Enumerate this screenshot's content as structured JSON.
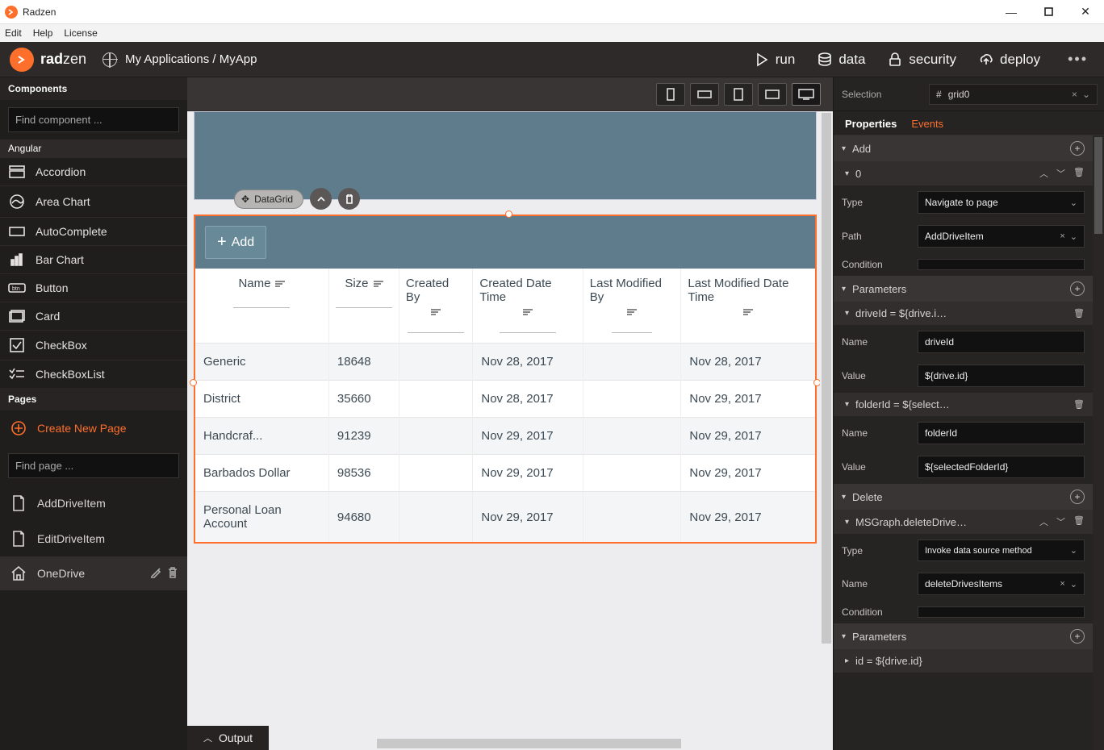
{
  "app_title": "Radzen",
  "menubar": [
    "Edit",
    "Help",
    "License"
  ],
  "brand": {
    "bold": "rad",
    "rest": "zen"
  },
  "breadcrumb": "My Applications / MyApp",
  "top_actions": [
    {
      "id": "run",
      "label": "run"
    },
    {
      "id": "data",
      "label": "data"
    },
    {
      "id": "security",
      "label": "security"
    },
    {
      "id": "deploy",
      "label": "deploy"
    }
  ],
  "components_header": "Components",
  "find_component_placeholder": "Find component ...",
  "component_group": "Angular",
  "components": [
    "Accordion",
    "Area Chart",
    "AutoComplete",
    "Bar Chart",
    "Button",
    "Card",
    "CheckBox",
    "CheckBoxList"
  ],
  "pages_header": "Pages",
  "create_page": "Create New Page",
  "find_page_placeholder": "Find page ...",
  "pages": [
    {
      "name": "AddDriveItem",
      "selected": false
    },
    {
      "name": "EditDriveItem",
      "selected": false
    },
    {
      "name": "OneDrive",
      "selected": true
    }
  ],
  "selection_label": "Selection",
  "selection_value": "grid0",
  "prop_tabs": {
    "properties": "Properties",
    "events": "Events"
  },
  "designer": {
    "tag_label": "DataGrid",
    "add_button": "Add",
    "columns": [
      "Name",
      "Size",
      "Created By",
      "Created Date Time",
      "Last Modified By",
      "Last Modified Date Time"
    ],
    "rows": [
      {
        "name": "Generic",
        "size": "18648",
        "created": "Nov 28, 2017",
        "modified": "Nov 28, 2017"
      },
      {
        "name": "District",
        "size": "35660",
        "created": "Nov 28, 2017",
        "modified": "Nov 29, 2017"
      },
      {
        "name": "Handcraf...",
        "size": "91239",
        "created": "Nov 29, 2017",
        "modified": "Nov 29, 2017"
      },
      {
        "name": "Barbados Dollar",
        "size": "98536",
        "created": "Nov 29, 2017",
        "modified": "Nov 29, 2017"
      },
      {
        "name": "Personal Loan Account",
        "size": "94680",
        "created": "Nov 29, 2017",
        "modified": "Nov 29, 2017"
      }
    ]
  },
  "props_panel": {
    "add_section": "Add",
    "item0": "0",
    "type_label": "Type",
    "type_value": "Navigate to page",
    "path_label": "Path",
    "path_value": "AddDriveItem",
    "condition_label": "Condition",
    "condition_value": "",
    "params_section": "Parameters",
    "param1_header": "driveId = ${drive.i…",
    "param1_name_label": "Name",
    "param1_name_value": "driveId",
    "param1_value_label": "Value",
    "param1_value_value": "${drive.id}",
    "param2_header": "folderId = ${select…",
    "param2_name_label": "Name",
    "param2_name_value": "folderId",
    "param2_value_label": "Value",
    "param2_value_value": "${selectedFolderId}",
    "delete_section": "Delete",
    "delete_item": "MSGraph.deleteDrive…",
    "del_type_label": "Type",
    "del_type_value": "Invoke data source method",
    "del_name_label": "Name",
    "del_name_value": "deleteDrivesItems",
    "del_cond_label": "Condition",
    "del_cond_value": "",
    "del_params_section": "Parameters",
    "del_param_header": "id = ${drive.id}"
  },
  "output_tab": "Output"
}
